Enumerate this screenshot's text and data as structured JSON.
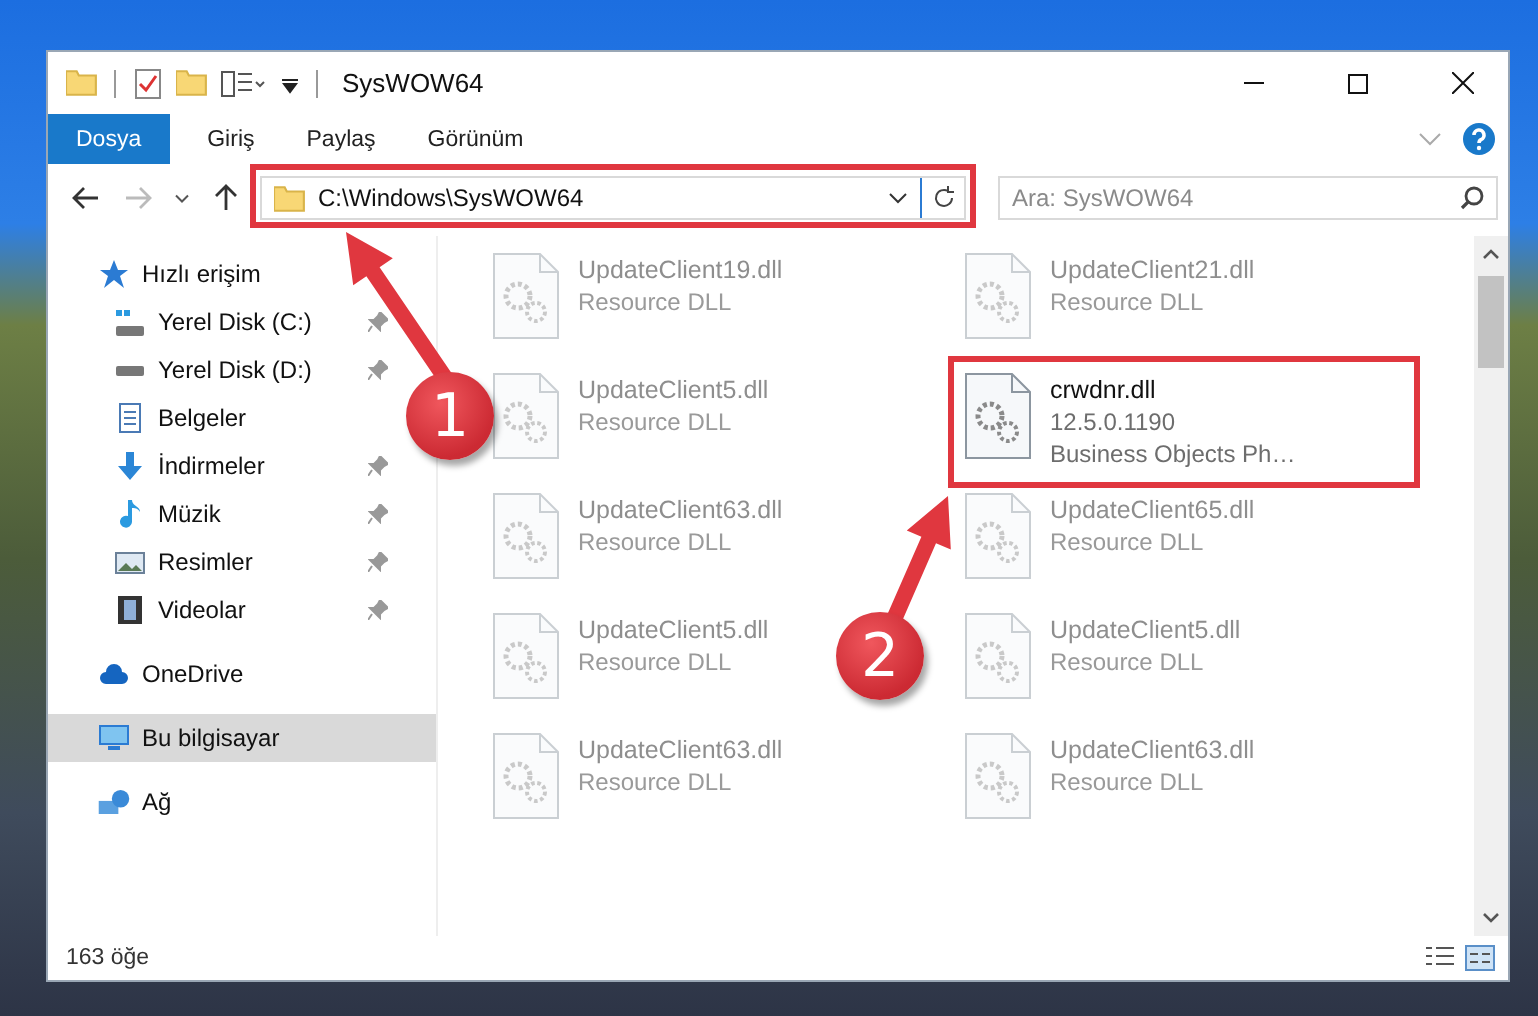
{
  "window": {
    "title": "SysWOW64"
  },
  "ribbon_tabs": [
    {
      "label": "Dosya",
      "kind": "file"
    },
    {
      "label": "Giriş",
      "kind": "tab"
    },
    {
      "label": "Paylaş",
      "kind": "tab"
    },
    {
      "label": "Görünüm",
      "kind": "tab"
    }
  ],
  "address": {
    "path": "C:\\Windows\\SysWOW64"
  },
  "search": {
    "placeholder": "Ara: SysWOW64"
  },
  "sidebar": {
    "items": [
      {
        "label": "Hızlı erişim",
        "kind": "star",
        "selected": false,
        "children": [
          {
            "label": "Yerel Disk (C:)",
            "kind": "drive-windows",
            "pinned": true,
            "selected": false
          },
          {
            "label": "Yerel Disk (D:)",
            "kind": "drive",
            "pinned": true,
            "selected": false
          },
          {
            "label": "Belgeler",
            "kind": "documents",
            "pinned": false,
            "selected": false
          },
          {
            "label": "İndirmeler",
            "kind": "download",
            "pinned": true,
            "selected": false
          },
          {
            "label": "Müzik",
            "kind": "music",
            "pinned": true,
            "selected": false
          },
          {
            "label": "Resimler",
            "kind": "pictures",
            "pinned": true,
            "selected": false
          },
          {
            "label": "Videolar",
            "kind": "videos",
            "pinned": true,
            "selected": false
          }
        ]
      },
      {
        "label": "OneDrive",
        "kind": "cloud",
        "selected": false
      },
      {
        "label": "Bu bilgisayar",
        "kind": "computer",
        "selected": true
      },
      {
        "label": "Ağ",
        "kind": "network",
        "selected": false
      }
    ]
  },
  "files": [
    {
      "name": "UpdateClient19.dll",
      "details": [
        "Resource DLL"
      ],
      "dimmed": true
    },
    {
      "name": "UpdateClient21.dll",
      "details": [
        "Resource DLL"
      ],
      "dimmed": true
    },
    {
      "name": "UpdateClient5.dll",
      "details": [
        "Resource DLL"
      ],
      "dimmed": true
    },
    {
      "name": "crwdnr.dll",
      "details": [
        "12.5.0.1190",
        "Business Objects Ph…"
      ],
      "dimmed": false
    },
    {
      "name": "UpdateClient63.dll",
      "details": [
        "Resource DLL"
      ],
      "dimmed": true
    },
    {
      "name": "UpdateClient65.dll",
      "details": [
        "Resource DLL"
      ],
      "dimmed": true
    },
    {
      "name": "UpdateClient5.dll",
      "details": [
        "Resource DLL"
      ],
      "dimmed": true
    },
    {
      "name": "UpdateClient5.dll",
      "details": [
        "Resource DLL"
      ],
      "dimmed": true
    },
    {
      "name": "UpdateClient63.dll",
      "details": [
        "Resource DLL"
      ],
      "dimmed": true
    },
    {
      "name": "UpdateClient63.dll",
      "details": [
        "Resource DLL"
      ],
      "dimmed": true
    }
  ],
  "status_bar": {
    "count": "163 öğe"
  },
  "annotations": [
    {
      "label": "1"
    },
    {
      "label": "2"
    }
  ]
}
